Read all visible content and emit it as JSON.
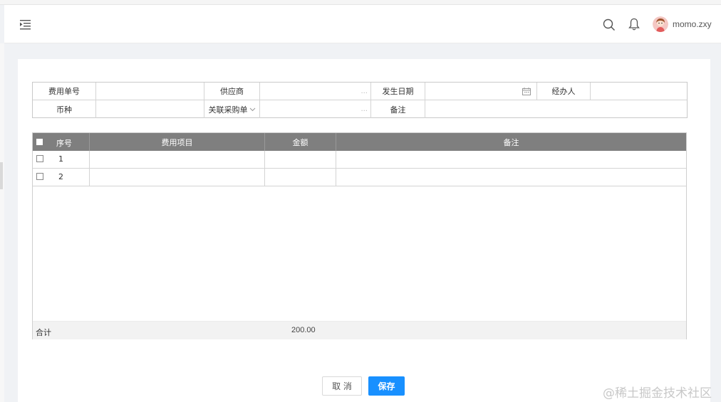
{
  "header": {
    "username": "momo.zxy",
    "icons": [
      "menu-fold-icon",
      "search-icon",
      "bell-icon",
      "avatar"
    ]
  },
  "form": {
    "row1": {
      "expense_no_label": "费用单号",
      "supplier_label": "供应商",
      "supplier_picker": "...",
      "date_label": "发生日期",
      "handler_label": "经办人"
    },
    "row2": {
      "currency_label": "币种",
      "purchase_select": "关联采购单",
      "purchase_picker": "...",
      "remark_label": "备注"
    }
  },
  "table": {
    "columns": [
      "序号",
      "费用项目",
      "金额",
      "备注"
    ],
    "rows": [
      {
        "seq": "1",
        "item": "",
        "amount": "",
        "remark": ""
      },
      {
        "seq": "2",
        "item": "",
        "amount": "",
        "remark": ""
      }
    ],
    "total_label": "合计",
    "total_value": "200.00"
  },
  "actions": {
    "cancel": "取 消",
    "save": "保存"
  },
  "watermark": "@稀土掘金技术社区",
  "colors": {
    "primary": "#1890ff",
    "table_header": "#7f7f7f",
    "background": "#f0f2f5"
  }
}
